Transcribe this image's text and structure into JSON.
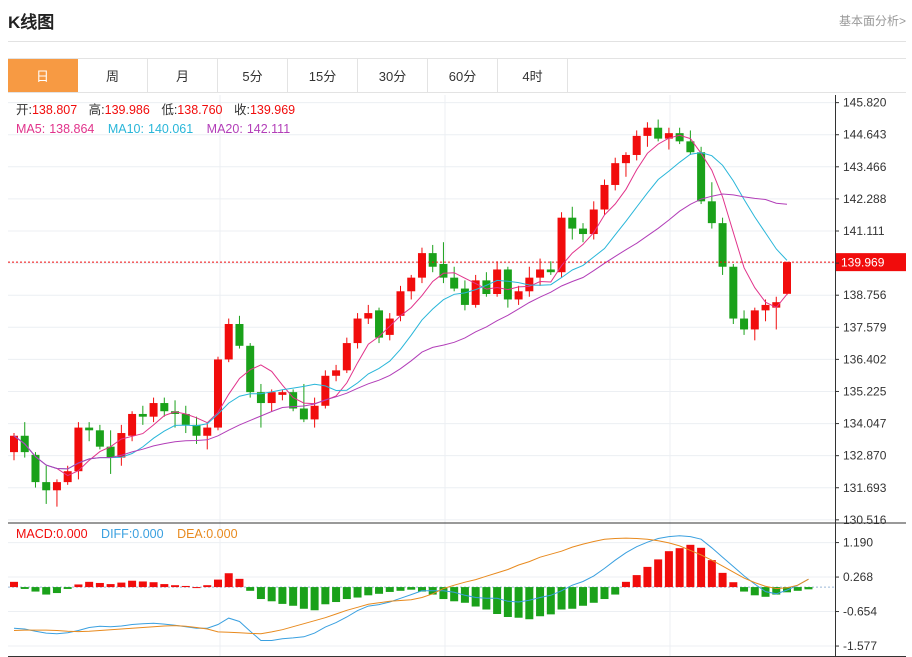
{
  "header": {
    "title": "K线图",
    "fundamental_link": "基本面分析>"
  },
  "tabs": [
    {
      "label": "日",
      "active": true
    },
    {
      "label": "周",
      "active": false
    },
    {
      "label": "月",
      "active": false
    },
    {
      "label": "5分",
      "active": false
    },
    {
      "label": "15分",
      "active": false
    },
    {
      "label": "30分",
      "active": false
    },
    {
      "label": "60分",
      "active": false
    },
    {
      "label": "4时",
      "active": false
    }
  ],
  "colors": {
    "up": "#f10c0c",
    "down": "#1aa11a",
    "ma5": "#e1338b",
    "ma10": "#29b6d9",
    "ma20": "#b23eb8",
    "diff": "#3aa0e0",
    "dea": "#e88a1e",
    "accent": "#f79a43"
  },
  "ohlc": {
    "open_label": "开:",
    "open": "138.807",
    "high_label": "高:",
    "high": "139.986",
    "low_label": "低:",
    "low": "138.760",
    "close_label": "收:",
    "close": "139.969"
  },
  "ma": {
    "ma5_label": "MA5:",
    "ma5": "138.864",
    "ma10_label": "MA10:",
    "ma10": "140.061",
    "ma20_label": "MA20:",
    "ma20": "142.111"
  },
  "macd": {
    "macd_label": "MACD:",
    "macd": "0.000",
    "diff_label": "DIFF:",
    "diff": "0.000",
    "dea_label": "DEA:",
    "dea": "0.000"
  },
  "chart_data": {
    "type": "candlestick",
    "price_axis": {
      "ticks": [
        "145.820",
        "144.643",
        "143.466",
        "142.288",
        "141.111",
        "139.934",
        "138.756",
        "137.579",
        "136.402",
        "135.225",
        "134.047",
        "132.870",
        "131.693",
        "130.516"
      ],
      "range": [
        130.4,
        146.1
      ],
      "last_price": "139.969"
    },
    "macd_axis": {
      "ticks": [
        "1.190",
        "0.268",
        "-0.654",
        "-1.577"
      ],
      "range": [
        -1.87,
        1.66
      ]
    },
    "candles": [
      [
        133.0,
        133.7,
        132.7,
        133.6
      ],
      [
        133.6,
        134.1,
        132.8,
        133.0
      ],
      [
        132.9,
        133.0,
        131.7,
        131.9
      ],
      [
        131.9,
        132.5,
        131.1,
        131.6
      ],
      [
        131.6,
        132.0,
        131.0,
        131.9
      ],
      [
        131.9,
        132.5,
        131.8,
        132.3
      ],
      [
        132.3,
        134.1,
        132.0,
        133.9
      ],
      [
        133.9,
        134.1,
        133.4,
        133.8
      ],
      [
        133.8,
        134.0,
        133.1,
        133.2
      ],
      [
        133.2,
        133.8,
        132.2,
        132.8
      ],
      [
        132.8,
        134.0,
        132.5,
        133.7
      ],
      [
        133.6,
        134.5,
        133.4,
        134.4
      ],
      [
        134.4,
        134.7,
        134.0,
        134.3
      ],
      [
        134.3,
        135.0,
        134.1,
        134.8
      ],
      [
        134.8,
        135.0,
        134.3,
        134.5
      ],
      [
        134.5,
        134.9,
        133.9,
        134.4
      ],
      [
        134.4,
        134.7,
        133.7,
        134.0
      ],
      [
        134.0,
        134.3,
        133.3,
        133.6
      ],
      [
        133.6,
        134.1,
        133.1,
        133.9
      ],
      [
        133.9,
        136.5,
        133.8,
        136.4
      ],
      [
        136.4,
        137.9,
        136.3,
        137.7
      ],
      [
        137.7,
        138.0,
        136.8,
        136.9
      ],
      [
        136.9,
        137.0,
        135.0,
        135.2
      ],
      [
        135.2,
        135.5,
        133.9,
        134.8
      ],
      [
        134.8,
        135.3,
        134.5,
        135.2
      ],
      [
        135.1,
        135.3,
        134.9,
        135.2
      ],
      [
        135.2,
        135.3,
        134.5,
        134.6
      ],
      [
        134.6,
        135.5,
        134.1,
        134.2
      ],
      [
        134.2,
        135.0,
        133.9,
        134.7
      ],
      [
        134.7,
        136.0,
        134.6,
        135.8
      ],
      [
        135.8,
        136.2,
        135.6,
        136.0
      ],
      [
        136.0,
        137.2,
        135.9,
        137.0
      ],
      [
        137.0,
        138.1,
        136.8,
        137.9
      ],
      [
        137.9,
        138.4,
        137.7,
        138.1
      ],
      [
        138.2,
        138.3,
        137.0,
        137.2
      ],
      [
        137.3,
        138.1,
        137.1,
        137.9
      ],
      [
        138.0,
        139.1,
        137.8,
        138.9
      ],
      [
        138.9,
        139.5,
        138.6,
        139.4
      ],
      [
        139.4,
        140.5,
        139.2,
        140.3
      ],
      [
        140.3,
        140.6,
        139.6,
        139.8
      ],
      [
        139.9,
        140.7,
        139.2,
        139.4
      ],
      [
        139.4,
        139.8,
        138.9,
        139.0
      ],
      [
        139.0,
        139.3,
        138.2,
        138.4
      ],
      [
        138.4,
        139.5,
        138.3,
        139.3
      ],
      [
        139.3,
        139.6,
        138.7,
        138.8
      ],
      [
        138.8,
        140.0,
        138.7,
        139.7
      ],
      [
        139.7,
        139.8,
        138.3,
        138.6
      ],
      [
        138.6,
        139.1,
        138.4,
        138.9
      ],
      [
        138.9,
        139.8,
        138.7,
        139.4
      ],
      [
        139.4,
        140.1,
        139.1,
        139.7
      ],
      [
        139.7,
        140.0,
        139.5,
        139.6
      ],
      [
        139.6,
        141.8,
        139.4,
        141.6
      ],
      [
        141.6,
        142.0,
        140.8,
        141.2
      ],
      [
        141.2,
        141.4,
        140.7,
        141.0
      ],
      [
        141.0,
        142.2,
        140.8,
        141.9
      ],
      [
        141.9,
        143.0,
        141.7,
        142.8
      ],
      [
        142.8,
        143.8,
        142.6,
        143.6
      ],
      [
        143.6,
        144.0,
        143.1,
        143.9
      ],
      [
        143.9,
        144.8,
        143.7,
        144.6
      ],
      [
        144.6,
        145.1,
        144.2,
        144.9
      ],
      [
        144.9,
        145.2,
        144.4,
        144.5
      ],
      [
        144.5,
        144.9,
        144.1,
        144.7
      ],
      [
        144.7,
        144.9,
        144.3,
        144.4
      ],
      [
        144.4,
        144.8,
        143.9,
        144.0
      ],
      [
        144.0,
        144.2,
        142.1,
        142.2
      ],
      [
        142.2,
        142.9,
        141.2,
        141.4
      ],
      [
        141.4,
        141.6,
        139.5,
        139.8
      ],
      [
        139.8,
        139.9,
        137.7,
        137.9
      ],
      [
        137.9,
        138.2,
        137.3,
        137.5
      ],
      [
        137.5,
        138.3,
        137.1,
        138.2
      ],
      [
        138.2,
        138.6,
        137.8,
        138.4
      ],
      [
        138.3,
        138.7,
        137.5,
        138.5
      ],
      [
        138.807,
        139.986,
        138.76,
        139.969
      ]
    ],
    "ma5_last": 138.864,
    "ma10_last": 140.061,
    "ma20_last": 142.111,
    "macd_hist": [
      0.14,
      -0.05,
      -0.12,
      -0.2,
      -0.16,
      -0.05,
      0.07,
      0.14,
      0.11,
      0.08,
      0.12,
      0.17,
      0.15,
      0.13,
      0.08,
      0.05,
      0.03,
      0.0,
      0.05,
      0.2,
      0.37,
      0.22,
      -0.1,
      -0.32,
      -0.38,
      -0.45,
      -0.5,
      -0.58,
      -0.62,
      -0.46,
      -0.4,
      -0.32,
      -0.28,
      -0.22,
      -0.18,
      -0.13,
      -0.1,
      -0.07,
      -0.12,
      -0.2,
      -0.32,
      -0.38,
      -0.42,
      -0.52,
      -0.6,
      -0.72,
      -0.8,
      -0.82,
      -0.86,
      -0.78,
      -0.73,
      -0.6,
      -0.58,
      -0.5,
      -0.42,
      -0.32,
      -0.2,
      0.14,
      0.32,
      0.54,
      0.74,
      0.96,
      1.04,
      1.13,
      1.05,
      0.72,
      0.38,
      0.13,
      -0.12,
      -0.22,
      -0.26,
      -0.2,
      -0.14,
      -0.1,
      -0.06
    ],
    "diff": [
      -1.1,
      -1.12,
      -1.18,
      -1.23,
      -1.25,
      -1.22,
      -1.16,
      -1.08,
      -1.05,
      -1.06,
      -1.04,
      -1.0,
      -0.98,
      -0.97,
      -0.99,
      -1.02,
      -1.06,
      -1.1,
      -1.1,
      -1.0,
      -0.83,
      -0.92,
      -1.18,
      -1.43,
      -1.43,
      -1.38,
      -1.36,
      -1.33,
      -1.23,
      -1.07,
      -0.95,
      -0.8,
      -0.63,
      -0.51,
      -0.47,
      -0.4,
      -0.3,
      -0.2,
      -0.1,
      -0.1,
      -0.1,
      -0.14,
      -0.22,
      -0.28,
      -0.3,
      -0.3,
      -0.38,
      -0.4,
      -0.35,
      -0.28,
      -0.22,
      -0.1,
      0.05,
      0.15,
      0.3,
      0.5,
      0.72,
      0.92,
      1.08,
      1.2,
      1.3,
      1.35,
      1.37,
      1.35,
      1.28,
      1.05,
      0.8,
      0.55,
      0.3,
      0.08,
      -0.12,
      -0.18,
      -0.08,
      0.05,
      0.21
    ],
    "dea": [
      -1.16,
      -1.15,
      -1.15,
      -1.15,
      -1.16,
      -1.18,
      -1.19,
      -1.18,
      -1.16,
      -1.14,
      -1.12,
      -1.1,
      -1.08,
      -1.06,
      -1.04,
      -1.03,
      -1.05,
      -1.08,
      -1.12,
      -1.2,
      -1.21,
      -1.22,
      -1.24,
      -1.25,
      -1.2,
      -1.14,
      -1.06,
      -0.98,
      -0.9,
      -0.82,
      -0.72,
      -0.62,
      -0.54,
      -0.46,
      -0.42,
      -0.38,
      -0.36,
      -0.34,
      -0.28,
      -0.18,
      -0.04,
      0.05,
      0.13,
      0.2,
      0.29,
      0.38,
      0.47,
      0.59,
      0.68,
      0.8,
      0.88,
      0.96,
      1.07,
      1.15,
      1.22,
      1.28,
      1.3,
      1.31,
      1.3,
      1.28,
      1.24,
      1.18,
      1.1,
      0.98,
      0.86,
      0.72,
      0.56,
      0.4,
      0.24,
      0.12,
      0.02,
      -0.04,
      -0.02,
      0.05,
      0.21
    ]
  }
}
